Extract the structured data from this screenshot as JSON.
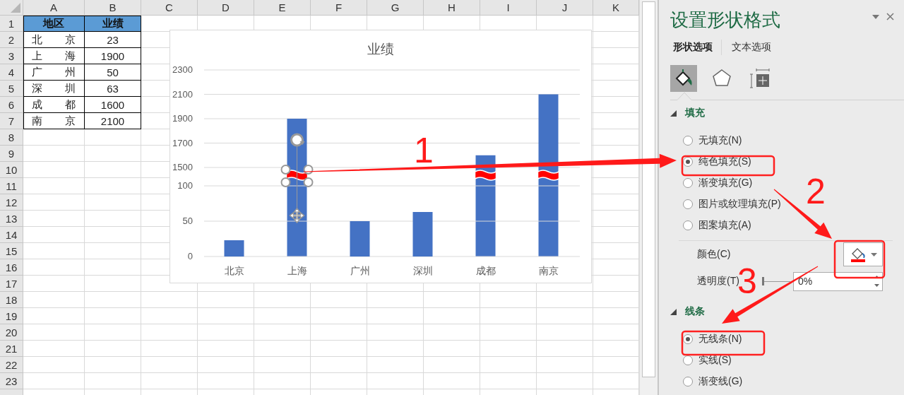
{
  "sheet": {
    "columns": [
      "A",
      "B",
      "C",
      "D",
      "E",
      "F",
      "G",
      "H",
      "I",
      "J",
      "K"
    ],
    "rows": [
      "1",
      "2",
      "3",
      "4",
      "5",
      "6",
      "7",
      "8",
      "9",
      "10",
      "11",
      "12",
      "13",
      "14",
      "15",
      "16",
      "17",
      "18",
      "19",
      "20",
      "21",
      "22",
      "23"
    ],
    "table": {
      "header": [
        "地区",
        "业绩"
      ],
      "rows": [
        [
          "北 京",
          "23"
        ],
        [
          "上 海",
          "1900"
        ],
        [
          "广 州",
          "50"
        ],
        [
          "深 圳",
          "63"
        ],
        [
          "成 都",
          "1600"
        ],
        [
          "南 京",
          "2100"
        ]
      ]
    }
  },
  "chart": {
    "title": "业绩",
    "panels": [
      {
        "chart_data": {
          "type": "bar",
          "values": [
            null,
            1900,
            null,
            null,
            1600,
            2100
          ],
          "ylim": [
            1500,
            2300
          ],
          "yticks": [
            1500,
            1700,
            1900,
            2100,
            2300
          ],
          "grid": true
        }
      },
      {
        "chart_data": {
          "type": "bar",
          "categories": [
            "北京",
            "上海",
            "广州",
            "深圳",
            "成都",
            "南京"
          ],
          "values": [
            23,
            null,
            50,
            63,
            null,
            null
          ],
          "ylim": [
            0,
            100
          ],
          "yticks": [
            0,
            50,
            100
          ],
          "grid": true
        }
      }
    ],
    "break_marks": [
      {
        "selected": true
      },
      {
        "selected": false
      },
      {
        "selected": false
      }
    ]
  },
  "pane": {
    "title": "设置形状格式",
    "tabs": [
      {
        "label": "形状选项",
        "selected": true
      },
      {
        "label": "文本选项",
        "selected": false
      }
    ],
    "icon_tabs": [
      {
        "kind": "fill",
        "selected": true
      },
      {
        "kind": "effects",
        "selected": false
      },
      {
        "kind": "size",
        "selected": false
      }
    ],
    "sections": [
      {
        "title": "填充",
        "expanded": true,
        "items": [
          {
            "kind": "radio",
            "label": "无填充(N)",
            "selected": false
          },
          {
            "kind": "radio",
            "label": "纯色填充(S)",
            "selected": true
          },
          {
            "kind": "radio",
            "label": "渐变填充(G)",
            "selected": false
          },
          {
            "kind": "radio",
            "label": "图片或纹理填充(P)",
            "selected": false
          },
          {
            "kind": "radio",
            "label": "图案填充(A)",
            "selected": false
          },
          {
            "kind": "color",
            "label": "颜色(C)",
            "color": "#ff0000"
          },
          {
            "kind": "transparency",
            "label": "透明度(T)",
            "level": 0,
            "value": "0%"
          }
        ]
      },
      {
        "title": "线条",
        "expanded": true,
        "items": [
          {
            "kind": "radio",
            "label": "无线条(N)",
            "selected": true
          },
          {
            "kind": "radio",
            "label": "实线(S)",
            "selected": false
          },
          {
            "kind": "radio",
            "label": "渐变线(G)",
            "selected": false
          }
        ]
      }
    ]
  },
  "callouts": [
    {
      "label": "1"
    },
    {
      "label": "2"
    },
    {
      "label": "3"
    }
  ]
}
